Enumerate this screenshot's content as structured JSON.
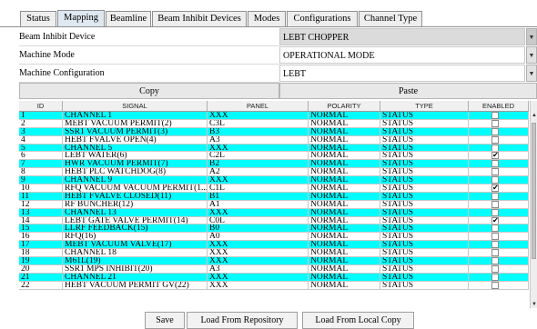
{
  "tabs": [
    {
      "label": "Status",
      "active": false
    },
    {
      "label": "Mapping",
      "active": true
    },
    {
      "label": "Beamline",
      "active": false
    },
    {
      "label": "Beam Inhibit Devices",
      "active": false
    },
    {
      "label": "Modes",
      "active": false
    },
    {
      "label": "Configurations",
      "active": false
    },
    {
      "label": "Channel Type",
      "active": false
    }
  ],
  "config": {
    "device_label": "Beam Inhibit Device",
    "device_value": "LEBT CHOPPER",
    "mode_label": "Machine Mode",
    "mode_value": "OPERATIONAL MODE",
    "configuration_label": "Machine Configuration",
    "configuration_value": "LEBT"
  },
  "actions": {
    "copy_label": "Copy",
    "paste_label": "Paste"
  },
  "table": {
    "columns": [
      "ID",
      "SIGNAL",
      "PANEL",
      "POLARITY",
      "TYPE",
      "ENABLED"
    ],
    "rows": [
      {
        "id": "1",
        "signal": "CHANNEL 1",
        "panel": "XXX",
        "polarity": "NORMAL",
        "type": "STATUS",
        "enabled": false,
        "highlight": true
      },
      {
        "id": "2",
        "signal": "MEBT VACUUM PERMIT(2)",
        "panel": "C3L",
        "polarity": "NORMAL",
        "type": "STATUS",
        "enabled": false,
        "highlight": false
      },
      {
        "id": "3",
        "signal": "SSR1 VACUUM PERMIT(3)",
        "panel": "B3",
        "polarity": "NORMAL",
        "type": "STATUS",
        "enabled": false,
        "highlight": true
      },
      {
        "id": "4",
        "signal": "HEBT FVALVE OPEN(4)",
        "panel": "A3",
        "polarity": "NORMAL",
        "type": "STATUS",
        "enabled": false,
        "highlight": false
      },
      {
        "id": "5",
        "signal": "CHANNEL 5",
        "panel": "XXX",
        "polarity": "NORMAL",
        "type": "STATUS",
        "enabled": false,
        "highlight": true
      },
      {
        "id": "6",
        "signal": "LEBT WATER(6)",
        "panel": "C2L",
        "polarity": "NORMAL",
        "type": "STATUS",
        "enabled": true,
        "highlight": false
      },
      {
        "id": "7",
        "signal": "HWR VACUUM PERMIT(7)",
        "panel": "B2",
        "polarity": "NORMAL",
        "type": "STATUS",
        "enabled": false,
        "highlight": true
      },
      {
        "id": "8",
        "signal": "HEBT PLC WATCHDOG(8)",
        "panel": "A2",
        "polarity": "NORMAL",
        "type": "STATUS",
        "enabled": false,
        "highlight": false
      },
      {
        "id": "9",
        "signal": "CHANNEL 9",
        "panel": "XXX",
        "polarity": "NORMAL",
        "type": "STATUS",
        "enabled": false,
        "highlight": true
      },
      {
        "id": "10",
        "signal": "RFQ VACUUM VACUUM PERMIT(1...",
        "panel": "C1L",
        "polarity": "NORMAL",
        "type": "STATUS",
        "enabled": true,
        "highlight": false
      },
      {
        "id": "11",
        "signal": "HEBT FVALVE CLOSED(11)",
        "panel": "B1",
        "polarity": "NORMAL",
        "type": "STATUS",
        "enabled": false,
        "highlight": true
      },
      {
        "id": "12",
        "signal": "RF BUNCHER(12)",
        "panel": "A1",
        "polarity": "NORMAL",
        "type": "STATUS",
        "enabled": false,
        "highlight": false
      },
      {
        "id": "13",
        "signal": "CHANNEL 13",
        "panel": "XXX",
        "polarity": "NORMAL",
        "type": "STATUS",
        "enabled": false,
        "highlight": true
      },
      {
        "id": "14",
        "signal": "LEBT GATE VALVE PERMIT(14)",
        "panel": "C0L",
        "polarity": "NORMAL",
        "type": "STATUS",
        "enabled": true,
        "highlight": false
      },
      {
        "id": "15",
        "signal": "LLRF FEEDBACK(15)",
        "panel": "B0",
        "polarity": "NORMAL",
        "type": "STATUS",
        "enabled": false,
        "highlight": true
      },
      {
        "id": "16",
        "signal": "RFQ(16)",
        "panel": "A0",
        "polarity": "NORMAL",
        "type": "STATUS",
        "enabled": false,
        "highlight": false
      },
      {
        "id": "17",
        "signal": "MEBT VACUUM VALVE(17)",
        "panel": "XXX",
        "polarity": "NORMAL",
        "type": "STATUS",
        "enabled": false,
        "highlight": true
      },
      {
        "id": "18",
        "signal": "CHANNEL 18",
        "panel": "XXX",
        "polarity": "NORMAL",
        "type": "STATUS",
        "enabled": false,
        "highlight": false
      },
      {
        "id": "19",
        "signal": "M61L(19)",
        "panel": "XXX",
        "polarity": "NORMAL",
        "type": "STATUS",
        "enabled": false,
        "highlight": true
      },
      {
        "id": "20",
        "signal": "SSR1 MPS INHIBIT(20)",
        "panel": "A3",
        "polarity": "NORMAL",
        "type": "STATUS",
        "enabled": false,
        "highlight": false
      },
      {
        "id": "21",
        "signal": "CHANNEL 21",
        "panel": "XXX",
        "polarity": "NORMAL",
        "type": "STATUS",
        "enabled": false,
        "highlight": true
      },
      {
        "id": "22",
        "signal": "HEBT VACUUM PERMIT GV(22)",
        "panel": "XXX",
        "polarity": "NORMAL",
        "type": "STATUS",
        "enabled": false,
        "highlight": false
      }
    ]
  },
  "footer": {
    "save_label": "Save",
    "load_repo_label": "Load From Repository",
    "load_local_label": "Load From Local Copy"
  },
  "colors": {
    "highlight": "#00ffff",
    "active_tab": "#dfe8f1",
    "field_bg": "#dbdbdb"
  }
}
